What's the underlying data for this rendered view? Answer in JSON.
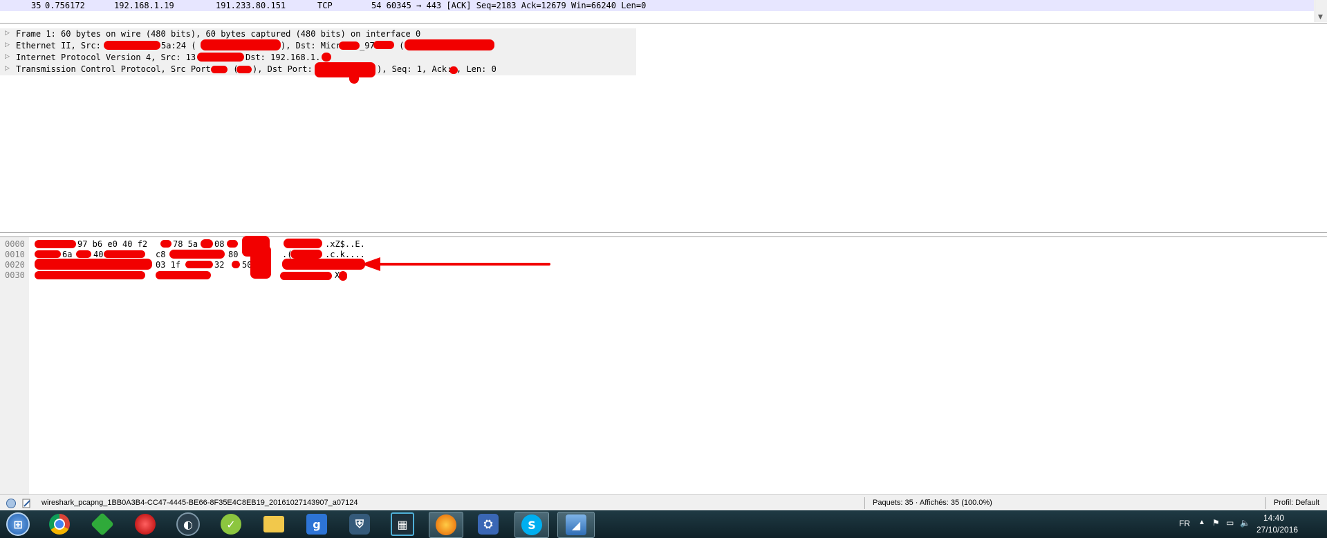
{
  "packet_list": {
    "selected_row": {
      "no": "35",
      "time": "0.756172",
      "source": "192.168.1.19",
      "destination": "191.233.80.151",
      "protocol": "TCP",
      "length_info": "54 60345 → 443 [ACK] Seq=2183 Ack=12679 Win=66240 Len=0"
    }
  },
  "details": {
    "rows": [
      "Frame 1: 60 bytes on wire (480 bits), 60 bytes captured (480 bits) on interface 0",
      "Ethernet II, Src: ",
      "Internet Protocol Version 4, Src: 13.",
      "Transmission Control Protocol, Src Port: "
    ],
    "eth_mid1": "5a:24 (",
    "eth_mid2": "), Dst: Micro-",
    "eth_mid3": "_97:",
    "eth_mid4": " (",
    "ip_mid1": "Dst: 192.168.1.",
    "tcp_mid1": " (",
    "tcp_mid2": "), Dst Port: ",
    "tcp_mid3": "), Seq: 1, Ack: ",
    "tcp_mid4": ", Len: 0"
  },
  "bytes": {
    "rows": [
      {
        "offset": "0000",
        "hex_visible": "97 b6 e0 40 f2",
        "hex_visible2": "78 5a",
        "hex_visible3": "08",
        "ascii": ".xZ$..E."
      },
      {
        "offset": "0010",
        "hex_visible": "6a",
        "hex_visible2": "40",
        "hex_visible3": "c8",
        "hex_visible4": "80",
        "ascii_prefix": ".(",
        "ascii": ".c.k...."
      },
      {
        "offset": "0020",
        "hex_visible": "03 1f 8c",
        "hex_visible2": "32",
        "hex_visible3": "50",
        "ascii": ""
      },
      {
        "offset": "0030",
        "hex_visible": "",
        "ascii": "X"
      }
    ]
  },
  "statusbar": {
    "filename": "wireshark_pcapng_1BB0A3B4-CC47-4445-BE66-8F35E4C8EB19_20161027143907_a07124",
    "packets": "Paquets: 35 · Affichés: 35 (100.0%)",
    "profile": "Profil: Default"
  },
  "taskbar": {
    "items": [
      "start-orb",
      "chrome",
      "greenshot",
      "red-app",
      "steam",
      "cleanmaster",
      "explorer",
      "gametracker",
      "security",
      "film",
      "firefox",
      "network-app",
      "skype",
      "wireshark"
    ],
    "clock_time": "14:40",
    "clock_date": "27/10/2016",
    "language": "FR"
  },
  "colors": {
    "selected_row": "#e7e6ff",
    "redaction": "#f20000",
    "tree_row": "#f0f0f0",
    "taskbar": "#1f3a44"
  }
}
